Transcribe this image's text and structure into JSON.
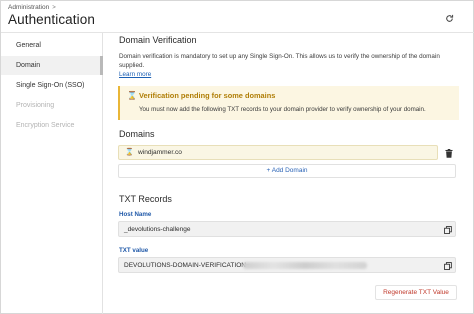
{
  "header": {
    "breadcrumb": "Administration",
    "title": "Authentication"
  },
  "sidebar": {
    "items": [
      {
        "label": "General",
        "state": "normal"
      },
      {
        "label": "Domain",
        "state": "active"
      },
      {
        "label": "Single Sign-On (SSO)",
        "state": "normal"
      },
      {
        "label": "Provisioning",
        "state": "disabled"
      },
      {
        "label": "Encryption Service",
        "state": "disabled"
      }
    ]
  },
  "domain_verification": {
    "title": "Domain Verification",
    "description": "Domain verification is mandatory to set up any Single Sign-On. This allows us to verify the ownership of the domain supplied.",
    "learn_more": "Learn more",
    "alert": {
      "title": "Verification pending for some domains",
      "body": "You must now add the following TXT records to your domain provider to verify ownership of your domain."
    }
  },
  "domains": {
    "title": "Domains",
    "items": [
      {
        "name": "windjammer.co",
        "status_color": "#d19a12"
      }
    ],
    "add_label": "+ Add Domain"
  },
  "txt_records": {
    "title": "TXT Records",
    "host_name_label": "Host Name",
    "host_name_value": "_devolutions-challenge",
    "txt_value_label": "TXT value",
    "txt_value_prefix": "DEVOLUTIONS-DOMAIN-VERIFICATION=",
    "regenerate_label": "Regenerate TXT Value"
  },
  "colors": {
    "accent": "#1f58a8",
    "warning": "#e9b637",
    "danger": "#c0392b"
  }
}
